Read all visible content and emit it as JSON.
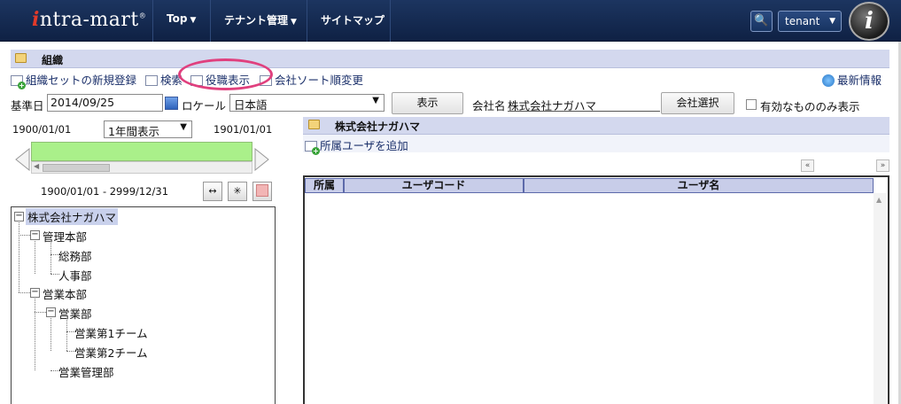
{
  "header": {
    "logo_prefix": "i",
    "logo_text": "ntra-mart",
    "nav": [
      {
        "label": "Top"
      },
      {
        "label": "テナント管理"
      },
      {
        "label": "サイトマップ"
      }
    ],
    "search_icon": "🔍",
    "tenant_label": "tenant",
    "avatar_letter": "i"
  },
  "title": "組織",
  "toolbar": {
    "new_org_set": "組織セットの新規登録",
    "search": "検索",
    "role_display": "役職表示",
    "company_sort": "会社ソート順変更",
    "latest_info": "最新情報"
  },
  "form": {
    "base_date_label": "基準日",
    "base_date_value": "2014/09/25",
    "locale_label": "ロケール",
    "locale_value": "日本語",
    "display_button": "表示",
    "company_name_label": "会社名",
    "company_name_value": "株式会社ナガハマ",
    "company_select_button": "会社選択",
    "valid_only_label": "有効なもののみ表示"
  },
  "timeline": {
    "start": "1900/01/01",
    "period_option": "1年間表示",
    "end": "1901/01/01",
    "range": "1900/01/01 - 2999/12/31"
  },
  "tree": {
    "root": "株式会社ナガハマ",
    "admin_hq": "管理本部",
    "general_affairs": "総務部",
    "hr": "人事部",
    "sales_hq": "営業本部",
    "sales_dept": "営業部",
    "sales_team1": "営業第1チーム",
    "sales_team2": "営業第2チーム",
    "sales_mgmt": "営業管理部"
  },
  "right_panel": {
    "title": "株式会社ナガハマ",
    "add_user": "所属ユーザを追加",
    "columns": [
      "所属",
      "ユーザコード",
      "ユーザ名"
    ]
  },
  "colors": {
    "header_bg": "#142a52",
    "panel_title_bg": "#d3d8ee",
    "timeline_green": "#aaf08a",
    "highlight": "#e0407e"
  }
}
